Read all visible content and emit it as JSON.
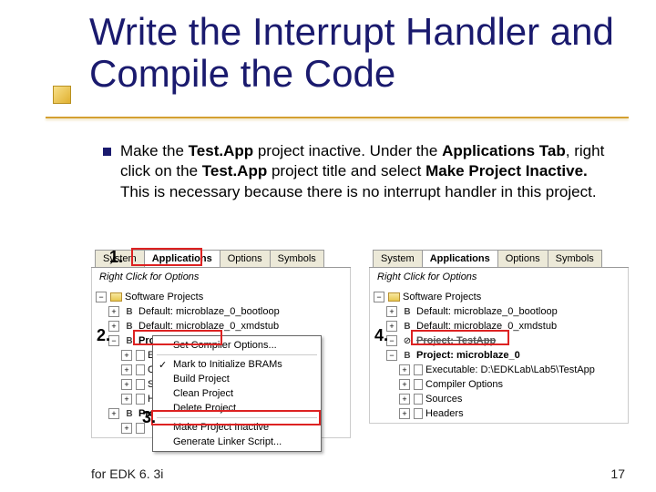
{
  "title": "Write the Interrupt Handler and Compile the Code",
  "bullet": {
    "pre": "Make the ",
    "b1": "Test.App",
    "mid1": " project inactive.  Under the ",
    "b2": "Applications Tab",
    "mid2": ", right click on the ",
    "b3": "Test.App",
    "mid3": " project title and select ",
    "b4": "Make Project Inactive.",
    "tail": "  This is necessary because there is no interrupt handler in this project."
  },
  "panel": {
    "tabs": [
      "System",
      "Applications",
      "Options",
      "Symbols"
    ],
    "rightclick": "Right Click for Options",
    "tree_root": "Software Projects",
    "items": {
      "bootloop": "Default: microblaze_0_bootloop",
      "xmdstub": "Default: microblaze_0_xmdstub",
      "testapp": "Project: TestApp",
      "app2": "Project: microblaze_0",
      "sub_exec_short": "Ex",
      "sub_co": "Co",
      "sub_so": "So",
      "sub_he": "He",
      "proj_label": "Proje",
      "sub_exec_full": "Executable: D:\\EDKLab\\Lab5\\TestApp",
      "sub_comp": "Compiler Options",
      "sub_src": "Sources",
      "sub_hdr": "Headers"
    }
  },
  "ctx": {
    "compiler": "Set Compiler Options...",
    "mark": "Mark to Initialize BRAMs",
    "build": "Build Project",
    "clean": "Clean Project",
    "delete": "Delete Project",
    "inactive": "Make Project Inactive",
    "linker": "Generate Linker Script..."
  },
  "steps": {
    "s1": "1.",
    "s2": "2.",
    "s3": "3.",
    "s4": "4."
  },
  "footer": {
    "left": "for EDK 6. 3i",
    "right": "17"
  }
}
